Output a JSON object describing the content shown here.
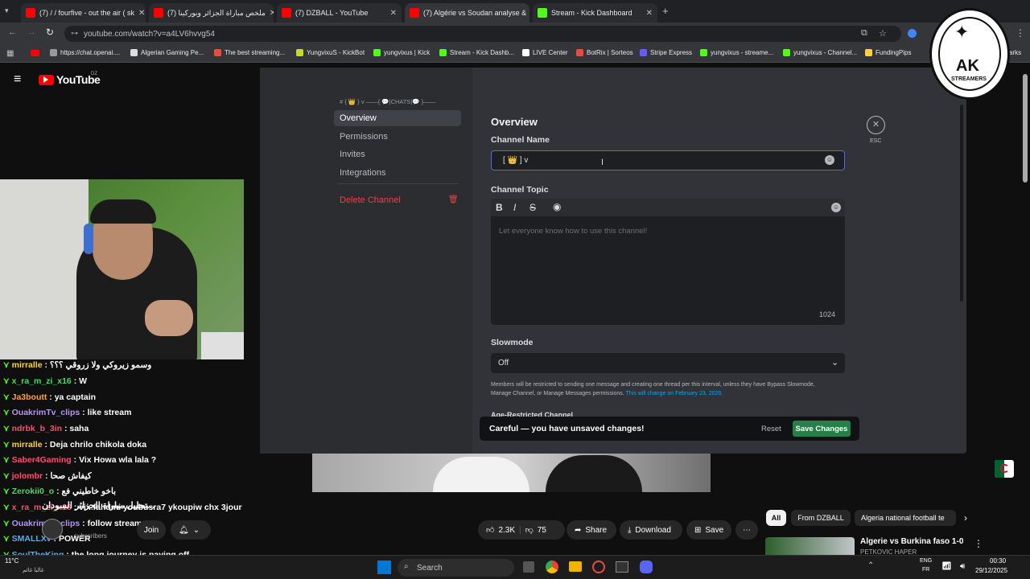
{
  "browser": {
    "tabs": [
      {
        "title": "(7) / / fourfive - out the air ( sk",
        "color": "#ff0000"
      },
      {
        "title": "ملخص مباراة الجزائر وبوركينا (7)",
        "color": "#ff0000"
      },
      {
        "title": "(7) DZBALL - YouTube",
        "color": "#ff0000"
      },
      {
        "title": "(7) Algérie vs Soudan analyse &",
        "color": "#ff0000"
      },
      {
        "title": "Stream - Kick Dashboard",
        "color": "#53fc18"
      }
    ],
    "url": "youtube.com/watch?v=a4LV6hvvg54",
    "bookmarks": [
      "https://chat.openai....",
      "Algerian Gaming Pe...",
      "The best streaming...",
      "YungvixuS - KickBot",
      "yungvixus | Kick",
      "Stream - Kick Dashb...",
      "LIVE Center",
      "BotRix | Sorteos",
      "Stripe Express",
      "yungvixus - streame...",
      "yungvixus - Channel...",
      "FundingPips"
    ],
    "bookmarks_overflow": "arks"
  },
  "youtube": {
    "logo": "YouTube",
    "region": "DZ",
    "video_title": "تحليل مباراة الجزائر السودان...",
    "channel_subscribers": "subscribers",
    "join": "Join",
    "likes": "2.3K",
    "dislikes": "75",
    "share": "Share",
    "download": "Download",
    "save": "Save",
    "chips": [
      "All",
      "From DZBALL",
      "Algeria national football te"
    ],
    "related_title": "Algerie vs Burkina faso 1-0",
    "related_sub": "PETKOVIC HAPER"
  },
  "chat": [
    {
      "user": "mirralle",
      "msg": ": وسمو زيروكي ولا زروقي ؟؟؟",
      "color": "#ffd23b"
    },
    {
      "user": "x_ra_m_zi_x16",
      "msg": ": W",
      "color": "#4cd964"
    },
    {
      "user": "Ja3boutt",
      "msg": ": ya captain",
      "color": "#ff9f43"
    },
    {
      "user": "OuakrimTv_clips",
      "msg": ": like stream",
      "color": "#b794f6"
    },
    {
      "user": "ndrbk_b_3in",
      "msg": ": saha",
      "color": "#ff4d6d"
    },
    {
      "user": "mirralle",
      "msg": ": Deja chrilo chikola doka",
      "color": "#ffd23b"
    },
    {
      "user": "Saber4Gaming",
      "msg": ": Vix Howa wla lala ?",
      "color": "#ff4d6d"
    },
    {
      "user": "jolombr",
      "msg": ": كيفاش صحا",
      "color": "#ff4d6d"
    },
    {
      "user": "Zerokii0_o",
      "msg": ": باخو خاطيني فع",
      "color": "#4cd964"
    },
    {
      "user": "x_ra_m_zi_x16",
      "msg": ": vix fahdmi youbusra7 ykoupiw chx 3jour",
      "color": "#ff4d6d"
    },
    {
      "user": "OuakrimTv_clips",
      "msg": ": follow stream",
      "color": "#b794f6"
    },
    {
      "user": "SMALLXv",
      "msg": ": POWER",
      "color": "#5dade2"
    },
    {
      "user": "SoulTheKing",
      "msg": ": the long journey is paying off",
      "color": "#5dade2"
    }
  ],
  "modal": {
    "breadcrumb": "# { 👑 } v ——{ 💬|CHATS|💬 }——",
    "nav": [
      "Overview",
      "Permissions",
      "Invites",
      "Integrations"
    ],
    "delete": "Delete Channel",
    "heading": "Overview",
    "channel_name_label": "Channel Name",
    "channel_name_value": "[ 👑 ] v",
    "channel_topic_label": "Channel Topic",
    "topic_placeholder": "Let everyone know how to use this channel!",
    "char_count": "1024",
    "slowmode_label": "Slowmode",
    "slowmode_value": "Off",
    "slowmode_help": "Members will be restricted to sending one message and creating one thread per this interval, unless they have Bypass Slowmode, Manage Channel, or Manage Messages permissions.",
    "slowmode_link": "This will change on February 23, 2026.",
    "age_label": "Age-Restricted Channel",
    "esc": "ESC",
    "unsaved": "Careful — you have unsaved changes!",
    "reset": "Reset",
    "save": "Save Changes"
  },
  "overlay": {
    "brand": "AK",
    "sub": "STREAMERS"
  },
  "taskbar": {
    "search": "Search",
    "weather": "11°C",
    "weather_sub": "غالبا غائم",
    "lang": "ENG",
    "lang_sub": "FR",
    "time": "00:30",
    "date": "29/12/2025"
  },
  "colors": {
    "discord_blurple": "#5865f2",
    "save_green": "#248046",
    "delete_red": "#f23f43",
    "kick_green": "#53fc18"
  }
}
